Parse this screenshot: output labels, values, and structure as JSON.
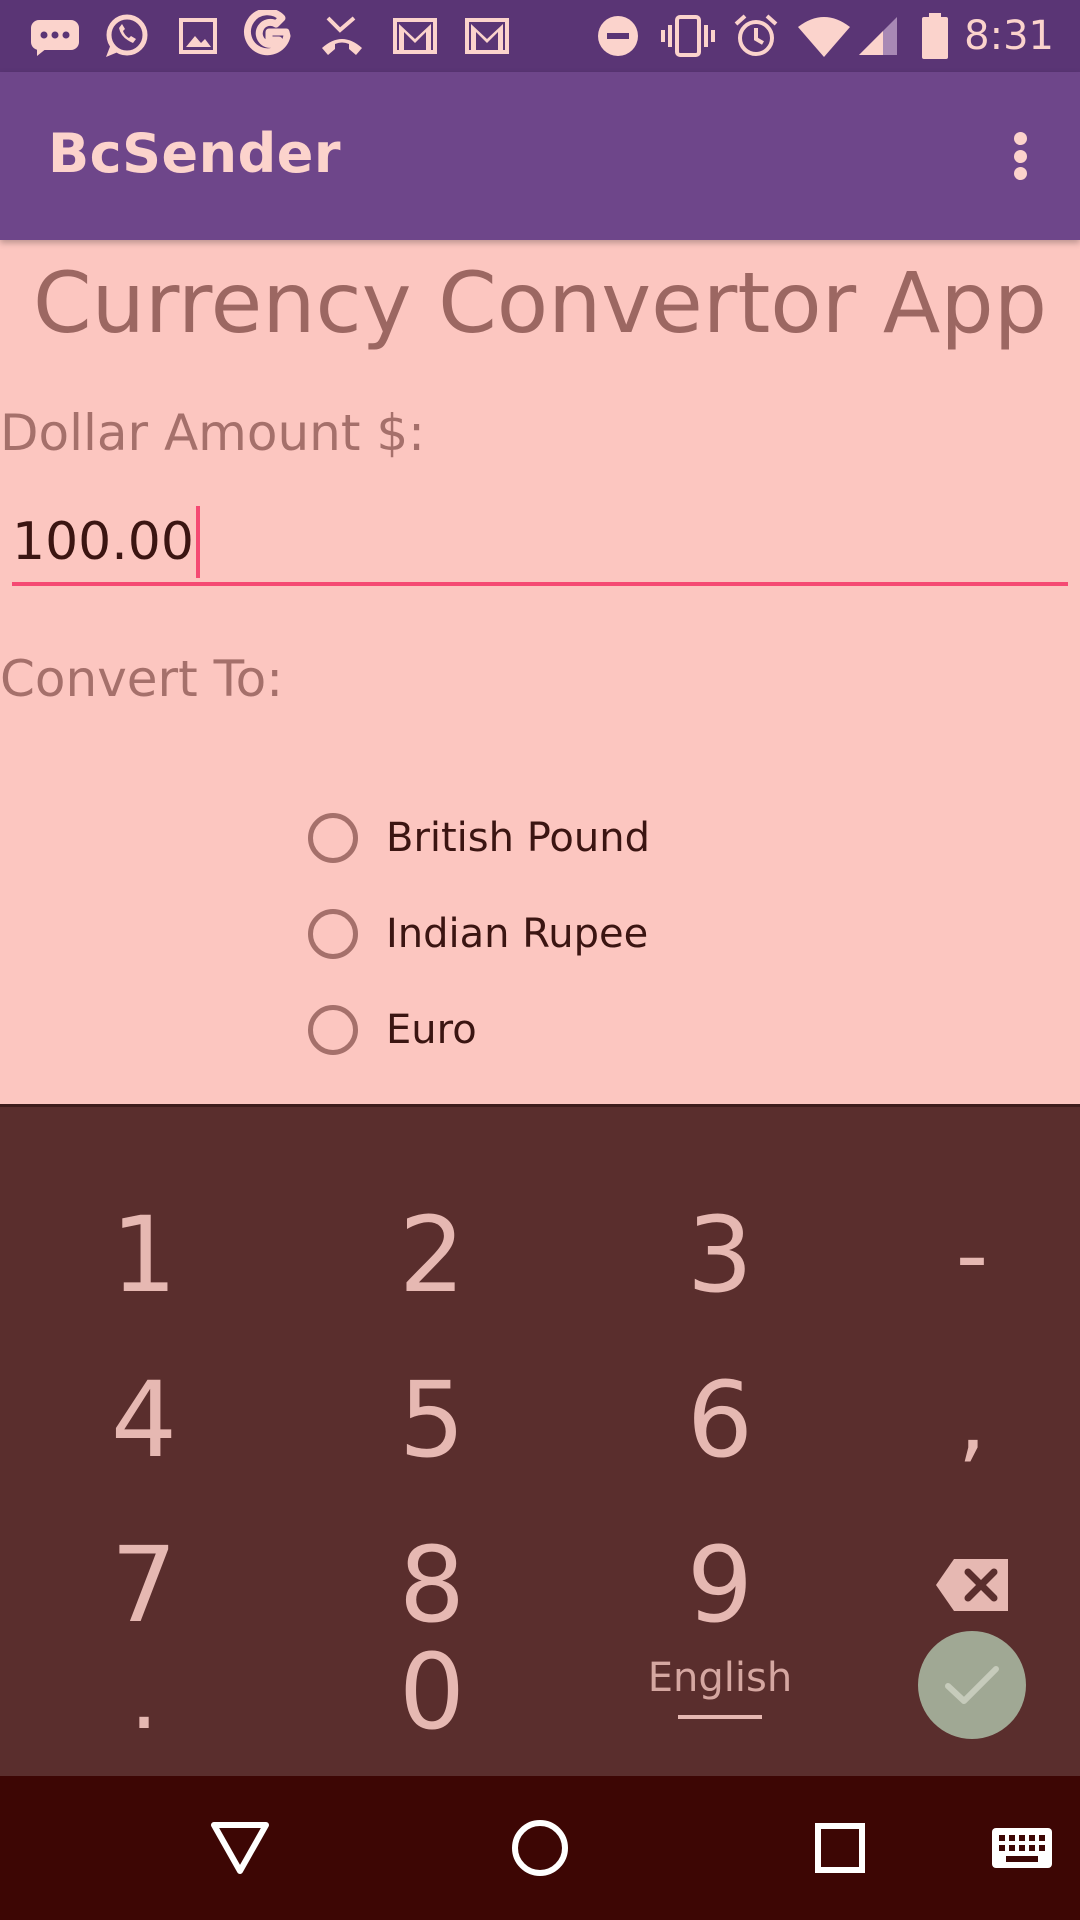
{
  "status_bar": {
    "time": "8:31",
    "notification_icons": [
      "messaging-icon",
      "whatsapp-icon",
      "gallery-icon",
      "google-icon",
      "missed-call-icon",
      "gmail-icon",
      "gmail-icon"
    ],
    "system_icons": [
      "do-not-disturb-icon",
      "vibrate-icon",
      "alarm-icon",
      "wifi-icon",
      "cellular-signal-icon",
      "battery-icon"
    ]
  },
  "app_bar": {
    "title": "BcSender",
    "overflow_icon": "more-vert-icon"
  },
  "content": {
    "title": "Currency Convertor App",
    "amount_label": "Dollar Amount $:",
    "amount_value": "100.00",
    "convert_label": "Convert To:",
    "options": [
      {
        "label": "British Pound",
        "selected": false
      },
      {
        "label": "Indian Rupee",
        "selected": false
      },
      {
        "label": "Euro",
        "selected": false
      }
    ]
  },
  "keyboard": {
    "rows": [
      [
        "1",
        "2",
        "3",
        "-"
      ],
      [
        "4",
        "5",
        "6",
        ","
      ],
      [
        "7",
        "8",
        "9"
      ],
      [
        ".",
        "0"
      ]
    ],
    "language": "English",
    "backspace_icon": "backspace-icon",
    "done_icon": "check-icon"
  },
  "nav_bar": {
    "icons": [
      "back-icon",
      "home-icon",
      "recents-icon",
      "keyboard-switch-icon"
    ]
  },
  "colors": {
    "status_bar": "#5a3575",
    "app_bar": "#6e468a",
    "background": "#fcc6c0",
    "accent": "#f54a73",
    "keyboard": "#5a2e2d",
    "nav_bar": "#3d0604",
    "done_button": "#a0a894"
  }
}
